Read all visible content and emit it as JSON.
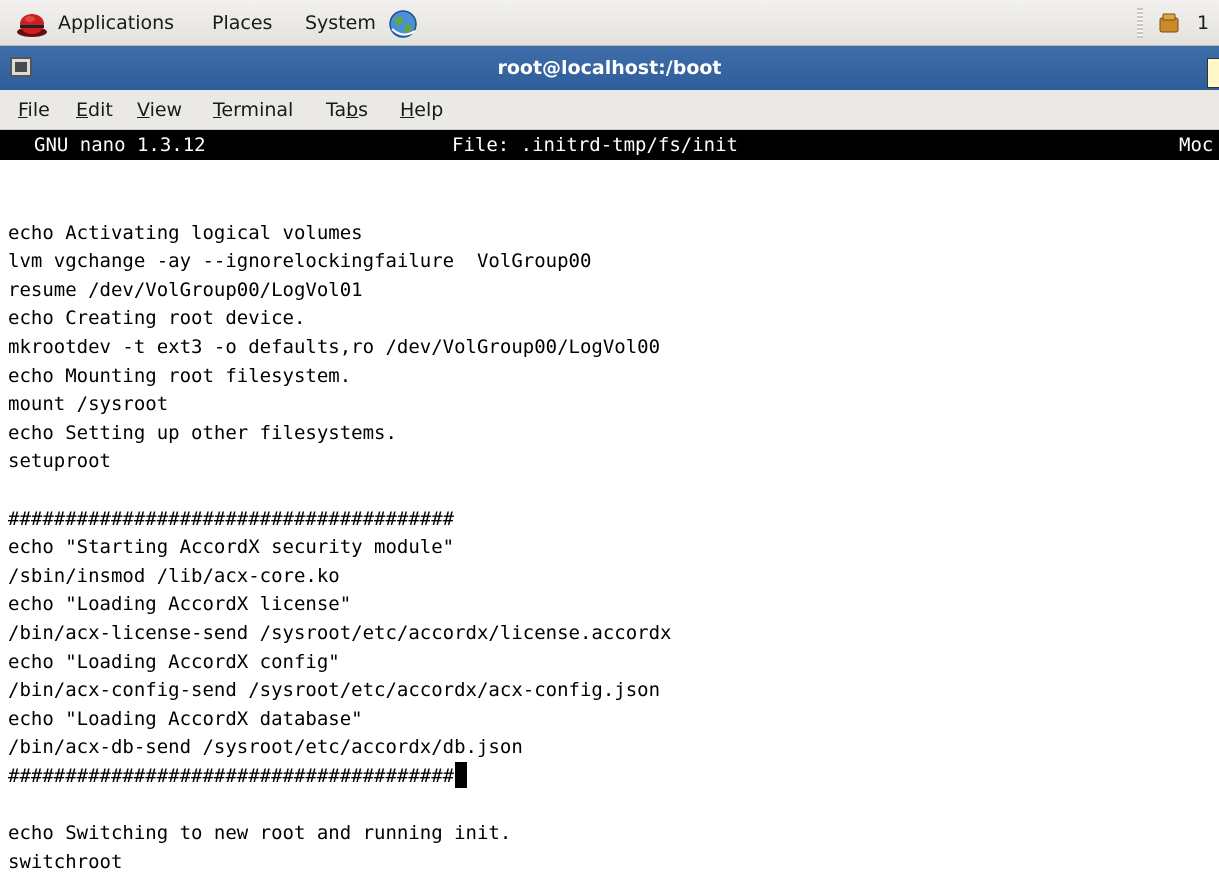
{
  "panel": {
    "menus": [
      "Applications",
      "Places",
      "System"
    ],
    "clock_fragment": "1"
  },
  "window": {
    "title": "root@localhost:/boot"
  },
  "menubar": {
    "items": [
      {
        "pre": "",
        "u": "F",
        "post": "ile"
      },
      {
        "pre": "",
        "u": "E",
        "post": "dit"
      },
      {
        "pre": "",
        "u": "V",
        "post": "iew"
      },
      {
        "pre": "",
        "u": "T",
        "post": "erminal"
      },
      {
        "pre": "Ta",
        "u": "b",
        "post": "s"
      },
      {
        "pre": "",
        "u": "H",
        "post": "elp"
      }
    ]
  },
  "nano": {
    "version": "GNU nano 1.3.12",
    "file": "File: .initrd-tmp/fs/init",
    "status": "Moc"
  },
  "editor": {
    "lines": [
      "",
      "echo Activating logical volumes",
      "lvm vgchange -ay --ignorelockingfailure  VolGroup00",
      "resume /dev/VolGroup00/LogVol01",
      "echo Creating root device.",
      "mkrootdev -t ext3 -o defaults,ro /dev/VolGroup00/LogVol00",
      "echo Mounting root filesystem.",
      "mount /sysroot",
      "echo Setting up other filesystems.",
      "setuproot",
      "",
      "#######################################",
      "echo \"Starting AccordX security module\"",
      "/sbin/insmod /lib/acx-core.ko",
      "echo \"Loading AccordX license\"",
      "/bin/acx-license-send /sysroot/etc/accordx/license.accordx",
      "echo \"Loading AccordX config\"",
      "/bin/acx-config-send /sysroot/etc/accordx/acx-config.json",
      "echo \"Loading AccordX database\"",
      "/bin/acx-db-send /sysroot/etc/accordx/db.json",
      "#######################################",
      "",
      "echo Switching to new root and running init.",
      "switchroot"
    ],
    "cursor_line": 20
  }
}
